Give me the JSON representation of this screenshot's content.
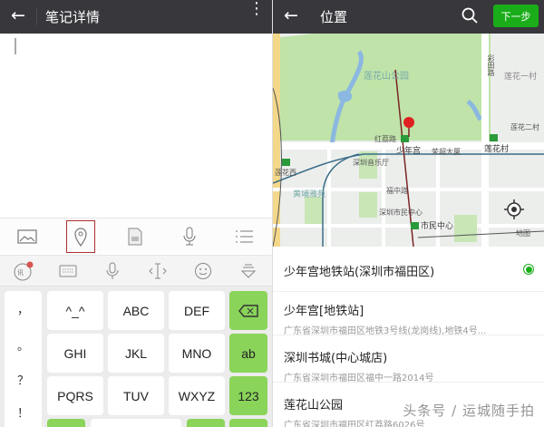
{
  "note_screen": {
    "title": "笔记详情",
    "back_icon": "←",
    "more_icon": "⋮",
    "toolbar": [
      "image-icon",
      "location-icon",
      "file-icon",
      "microphone-icon",
      "list-icon"
    ],
    "keyboard_top": [
      "ime-logo-icon",
      "keyboard-icon",
      "voice-icon",
      "cursor-move-icon",
      "emoji-icon",
      "hide-keyboard-icon"
    ],
    "punctuation": [
      "，",
      "。",
      "？",
      "！"
    ],
    "keys": [
      [
        "^_^",
        "ABC",
        "DEF"
      ],
      [
        "GHI",
        "JKL",
        "MNO"
      ],
      [
        "PQRS",
        "TUV",
        "WXYZ"
      ]
    ],
    "side_keys": {
      "delete_icon": "⌫",
      "ab": "ab",
      "num": "123"
    }
  },
  "location_screen": {
    "title": "位置",
    "next_label": "下一步",
    "map_labels": {
      "park": "莲花山公园",
      "village1": "莲花一村",
      "village2": "莲花二村",
      "road1": "红荔路",
      "station1": "少年宫",
      "station2": "莲花村",
      "hall": "深圳音乐厅",
      "estate": "黄埔雅苑",
      "road2": "福中路",
      "civic": "深圳市民中心",
      "station3": "市民中心",
      "tower": "荣超大厦",
      "west": "莲花西",
      "road3": "彩田路",
      "map_brand": "地图"
    },
    "places": [
      {
        "name": "少年宫地铁站(深圳市福田区)",
        "address": "",
        "selected": true
      },
      {
        "name": "少年宫[地铁站]",
        "address": "广东省深圳市福田区地铁3号线(龙岗线),地铁4号..."
      },
      {
        "name": "深圳书城(中心城店)",
        "address": "广东省深圳市福田区福中一路2014号"
      },
      {
        "name": "莲花山公园",
        "address": "广东省深圳市福田区红荔路6026号"
      }
    ],
    "watermark": "头条号 / 运城随手拍",
    "accent": "#1aad19"
  }
}
